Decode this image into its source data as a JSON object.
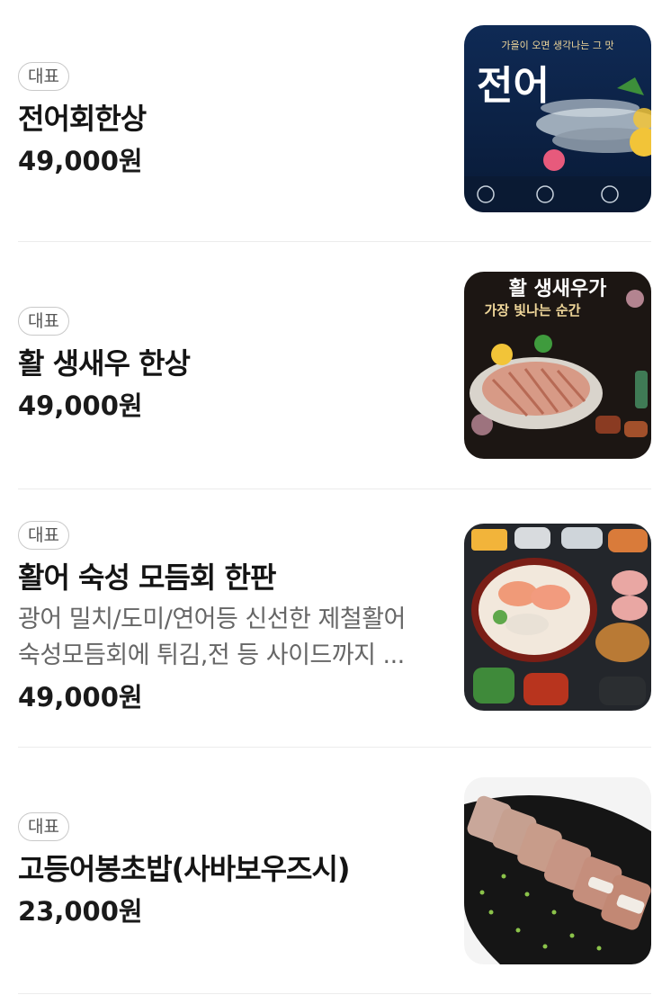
{
  "menu": {
    "items": [
      {
        "badge": "대표",
        "name": "전어회한상",
        "price": "49,000원",
        "image": {
          "top_text": "가을이 오면 생각나는 그 맛",
          "title": "전어"
        }
      },
      {
        "badge": "대표",
        "name": "활 생새우 한상",
        "price": "49,000원",
        "image": {
          "title": "활 생새우가",
          "subtitle": "가장 빛나는 순간"
        }
      },
      {
        "badge": "대표",
        "name": "활어 숙성 모듬회 한판",
        "desc1": "광어 밀치/도미/연어등 신선한 제철활어",
        "desc2": "숙성모듬회에 튀김,전 등 사이드까지 ...",
        "price": "49,000원"
      },
      {
        "badge": "대표",
        "name": "고등어봉초밥(사바보우즈시)",
        "price": "23,000원"
      }
    ]
  }
}
